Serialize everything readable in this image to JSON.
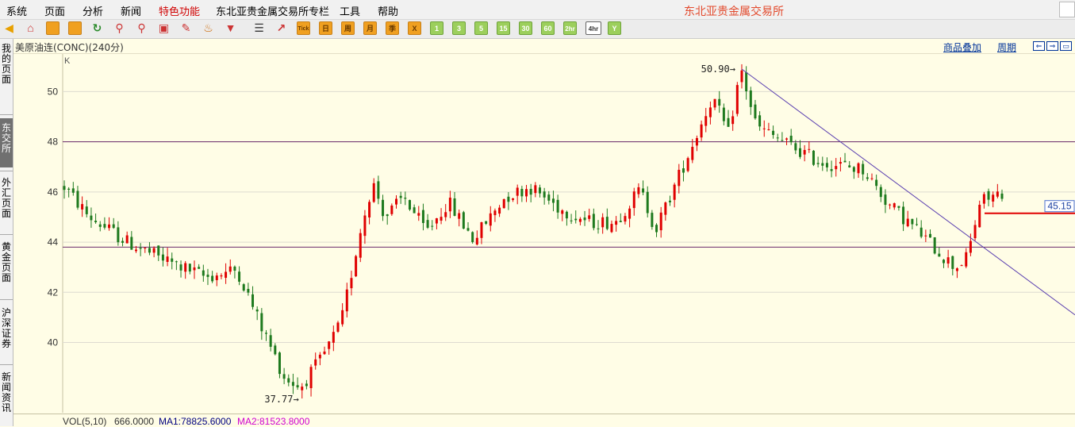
{
  "menu": [
    "系统",
    "页面",
    "分析",
    "新闻",
    "特色功能",
    "东北亚贵金属交易所专栏",
    "工具",
    "帮助"
  ],
  "brand": "东北亚贵金属交易所",
  "toolbar": {
    "icons": [
      "back-arrow-icon",
      "home-icon",
      "book-icon",
      "fund-icon",
      "refresh-icon",
      "zoom-in-icon",
      "zoom-out-icon",
      "window-icon",
      "pencil-icon",
      "bell-icon",
      "filter-icon",
      "list-icon",
      "kline-icon"
    ],
    "period_buttons": [
      "Tick",
      "日",
      "周",
      "月",
      "季",
      "X",
      "1",
      "3",
      "5",
      "15",
      "30",
      "60",
      "2hr",
      "4hr",
      "Y"
    ],
    "selected_period": "4hr"
  },
  "header": {
    "instrument": "美原油连(CONC)(240分)",
    "overlay_link": "商品叠加",
    "period_link": "周期"
  },
  "sidebar": [
    {
      "label": "我的页面",
      "active": false
    },
    {
      "label": "东交所",
      "active": true
    },
    {
      "label": "外汇页面",
      "active": false
    },
    {
      "label": "黄金页面",
      "active": false
    },
    {
      "label": "沪深证券",
      "active": false
    },
    {
      "label": "新闻资讯",
      "active": false
    }
  ],
  "chart_data": {
    "type": "candlestick",
    "indicator_label": "K",
    "y_ticks": [
      40,
      42,
      44,
      46,
      48,
      50
    ],
    "ylim": [
      37.2,
      51.5
    ],
    "horizontal_lines": [
      48.0,
      43.8
    ],
    "high_marker": {
      "label": "50.90",
      "value": 50.9
    },
    "low_marker": {
      "label": "37.77",
      "value": 37.77
    },
    "current_price": {
      "label": "45.15",
      "value": 45.15
    },
    "trendline": {
      "from_value": 50.9,
      "to_value": 41.1
    },
    "up_color": "#e00000",
    "down_color": "#1e7a1e",
    "bar_count": 210,
    "anchors": [
      [
        0,
        46.2
      ],
      [
        8,
        45.0
      ],
      [
        20,
        44.0
      ],
      [
        30,
        43.4
      ],
      [
        45,
        42.6
      ],
      [
        55,
        42.9
      ],
      [
        62,
        40.8
      ],
      [
        70,
        38.6
      ],
      [
        75,
        38.2
      ],
      [
        82,
        39.4
      ],
      [
        88,
        40.8
      ],
      [
        94,
        44.4
      ],
      [
        98,
        46.4
      ],
      [
        102,
        45.0
      ],
      [
        108,
        45.8
      ],
      [
        115,
        44.4
      ],
      [
        122,
        45.6
      ],
      [
        130,
        44.1
      ],
      [
        140,
        45.8
      ],
      [
        148,
        46.2
      ],
      [
        158,
        45.3
      ],
      [
        167,
        44.8
      ],
      [
        175,
        44.8
      ],
      [
        183,
        46.1
      ],
      [
        188,
        44.5
      ],
      [
        200,
        48.0
      ],
      [
        206,
        49.8
      ],
      [
        211,
        48.3
      ],
      [
        215,
        50.9
      ],
      [
        220,
        48.6
      ],
      [
        227,
        48.1
      ],
      [
        240,
        47.2
      ],
      [
        254,
        46.9
      ],
      [
        262,
        45.5
      ],
      [
        270,
        44.6
      ],
      [
        278,
        43.6
      ],
      [
        283,
        43.0
      ],
      [
        287,
        43.4
      ],
      [
        291,
        45.6
      ],
      [
        298,
        46.0
      ]
    ]
  },
  "volume": {
    "label": "VOL(5,10)",
    "value": "666.0000",
    "ma1_label": "MA1:78825.6000",
    "ma2_label": "MA2:81523.8000"
  },
  "colors": {
    "background": "#fffde6",
    "accent_red": "#e00000",
    "link_blue": "#003399",
    "line_purple": "#6a2a6a"
  }
}
